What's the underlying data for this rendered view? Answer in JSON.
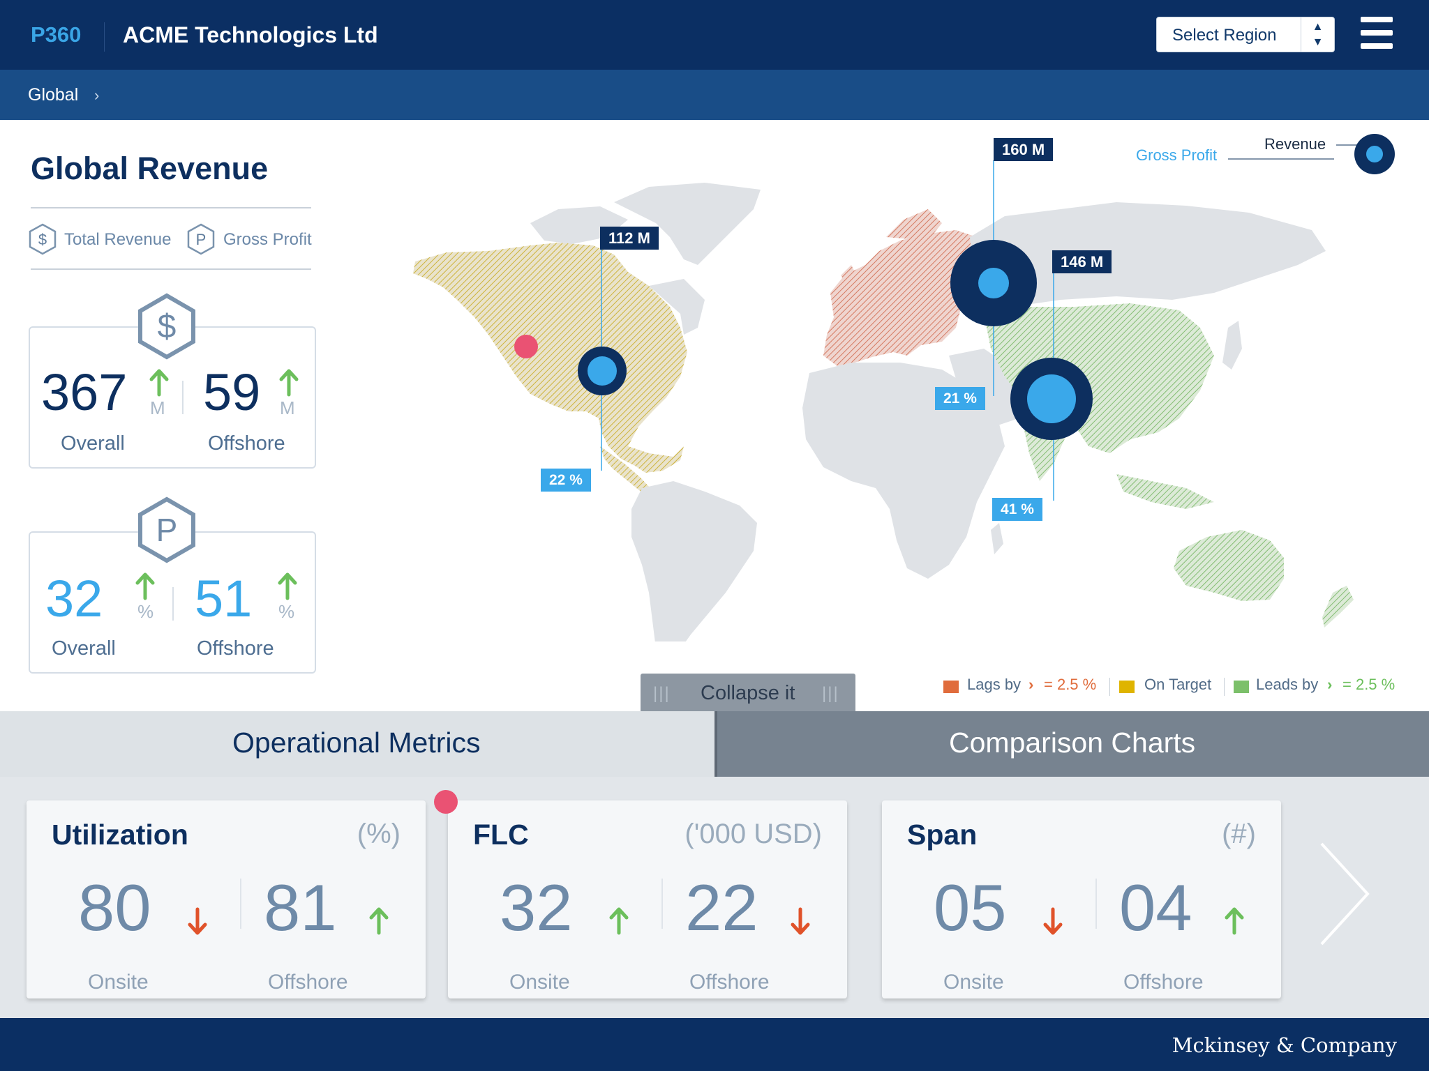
{
  "header": {
    "brand": "P360",
    "company": "ACME Technologics Ltd",
    "region_select": "Select Region"
  },
  "breadcrumb": {
    "current": "Global"
  },
  "revenue_panel": {
    "title": "Global Revenue",
    "legend": {
      "total_revenue": "Total Revenue",
      "gross_profit": "Gross Profit"
    },
    "total_revenue_card": {
      "overall_value": "367",
      "overall_unit": "M",
      "overall_label": "Overall",
      "offshore_value": "59",
      "offshore_unit": "M",
      "offshore_label": "Offshore"
    },
    "gross_profit_card": {
      "overall_value": "32",
      "overall_unit": "%",
      "overall_label": "Overall",
      "offshore_value": "51",
      "offshore_unit": "%",
      "offshore_label": "Offshore"
    }
  },
  "map": {
    "legend_revenue": "Revenue",
    "legend_gross_profit": "Gross Profit",
    "regions": [
      {
        "name": "North America",
        "revenue": "112 M",
        "gross_profit": "22 %",
        "status": "On Target"
      },
      {
        "name": "Europe / Russia",
        "revenue": "160 M",
        "gross_profit": "21 %",
        "status": "Lags"
      },
      {
        "name": "Asia",
        "revenue": "146 M",
        "gross_profit": "41 %",
        "status": "Leads"
      }
    ],
    "status_legend": {
      "lags_prefix": "Lags by",
      "lags_value": "= 2.5 %",
      "on_target": "On Target",
      "leads_prefix": "Leads by",
      "leads_value": "= 2.5 %"
    },
    "colors": {
      "lags": "#e06c3c",
      "on_target": "#dfb400",
      "leads": "#7cc06a"
    }
  },
  "collapse_button": "Collapse it",
  "tabs": {
    "operational": "Operational Metrics",
    "comparison": "Comparison Charts"
  },
  "metrics": [
    {
      "title": "Utilization",
      "unit": "(%)",
      "onsite": "80",
      "onsite_trend": "down",
      "onsite_label": "Onsite",
      "offshore": "81",
      "offshore_trend": "up",
      "offshore_label": "Offshore"
    },
    {
      "title": "FLC",
      "unit": "('000 USD)",
      "onsite": "32",
      "onsite_trend": "up",
      "onsite_label": "Onsite",
      "offshore": "22",
      "offshore_trend": "down",
      "offshore_label": "Offshore"
    },
    {
      "title": "Span",
      "unit": "(#)",
      "onsite": "05",
      "onsite_trend": "down",
      "onsite_label": "Onsite",
      "offshore": "04",
      "offshore_trend": "up",
      "offshore_label": "Offshore"
    }
  ],
  "footer": {
    "text": "Mckinsey & Company"
  }
}
